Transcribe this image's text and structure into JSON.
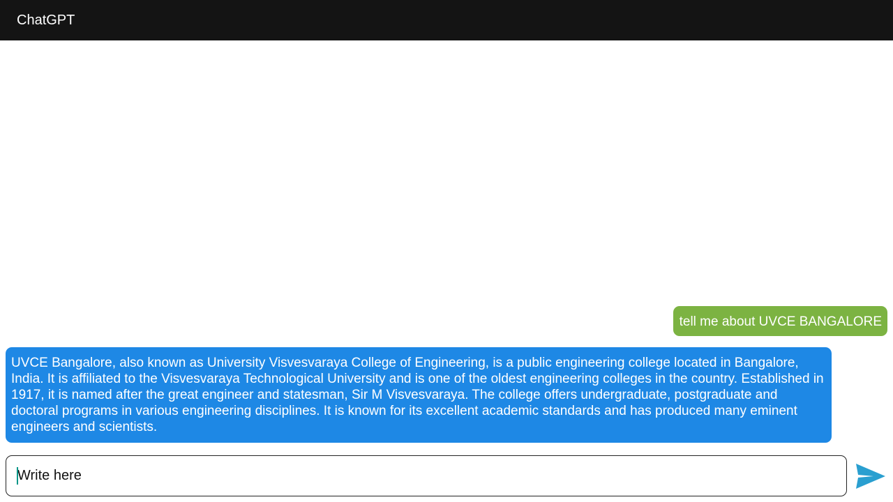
{
  "app": {
    "title": "ChatGPT"
  },
  "messages": [
    {
      "role": "user",
      "text": "tell me about UVCE BANGALORE",
      "color": "#7cb342"
    },
    {
      "role": "assistant",
      "text": "UVCE Bangalore, also known as University Visvesvaraya College of Engineering, is a public engineering college located in Bangalore, India. It is affiliated to the Visvesvaraya Technological University and is one of the oldest engineering colleges in the country. Established in 1917, it is named after the great engineer and statesman, Sir M Visvesvaraya. The college offers undergraduate, postgraduate and doctoral programs in various engineering disciplines. It is known for its excellent academic standards and has produced many eminent engineers and scientists.",
      "color": "#1e88e5"
    }
  ],
  "composer": {
    "value": "",
    "placeholder": "Write here",
    "send_icon": "send-icon",
    "send_color": "#2a9fd0"
  },
  "colors": {
    "toolbar": "#141414",
    "user_bubble": "#7cb342",
    "assistant_bubble": "#1e88e5"
  }
}
